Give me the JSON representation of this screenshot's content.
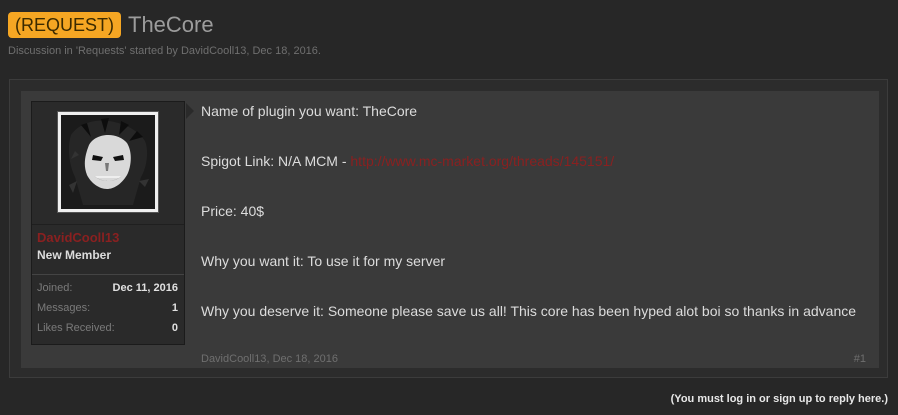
{
  "thread": {
    "prefix": "(REQUEST)",
    "title": "TheCore",
    "meta": "Discussion in 'Requests' started by DavidCooll13, Dec 18, 2016."
  },
  "author": {
    "username": "DavidCooll13",
    "usertitle": "New Member",
    "avatar_icon": "joker-avatar",
    "stats": [
      {
        "label": "Joined:",
        "value": "Dec 11, 2016"
      },
      {
        "label": "Messages:",
        "value": "1"
      },
      {
        "label": "Likes Received:",
        "value": "0"
      }
    ]
  },
  "post": {
    "line1": "Name of plugin you want: TheCore",
    "line2_prefix": "Spigot Link: N/A MCM - ",
    "line2_link": "http://www.mc-market.org/threads/145151/",
    "line3": "Price: 40$",
    "line4": "Why you want it: To use it for my server",
    "line5": "Why you deserve it: Someone please save us all! This core has been hyped alot boi so thanks in advance",
    "footer_author": "DavidCooll13",
    "footer_date": "Dec 18, 2016",
    "permalink": "#1"
  },
  "reply_note": "(You must log in or sign up to reply here.)",
  "colors": {
    "prefix_bg": "#f5a623",
    "username": "#8a2020",
    "link": "#8a2020"
  }
}
